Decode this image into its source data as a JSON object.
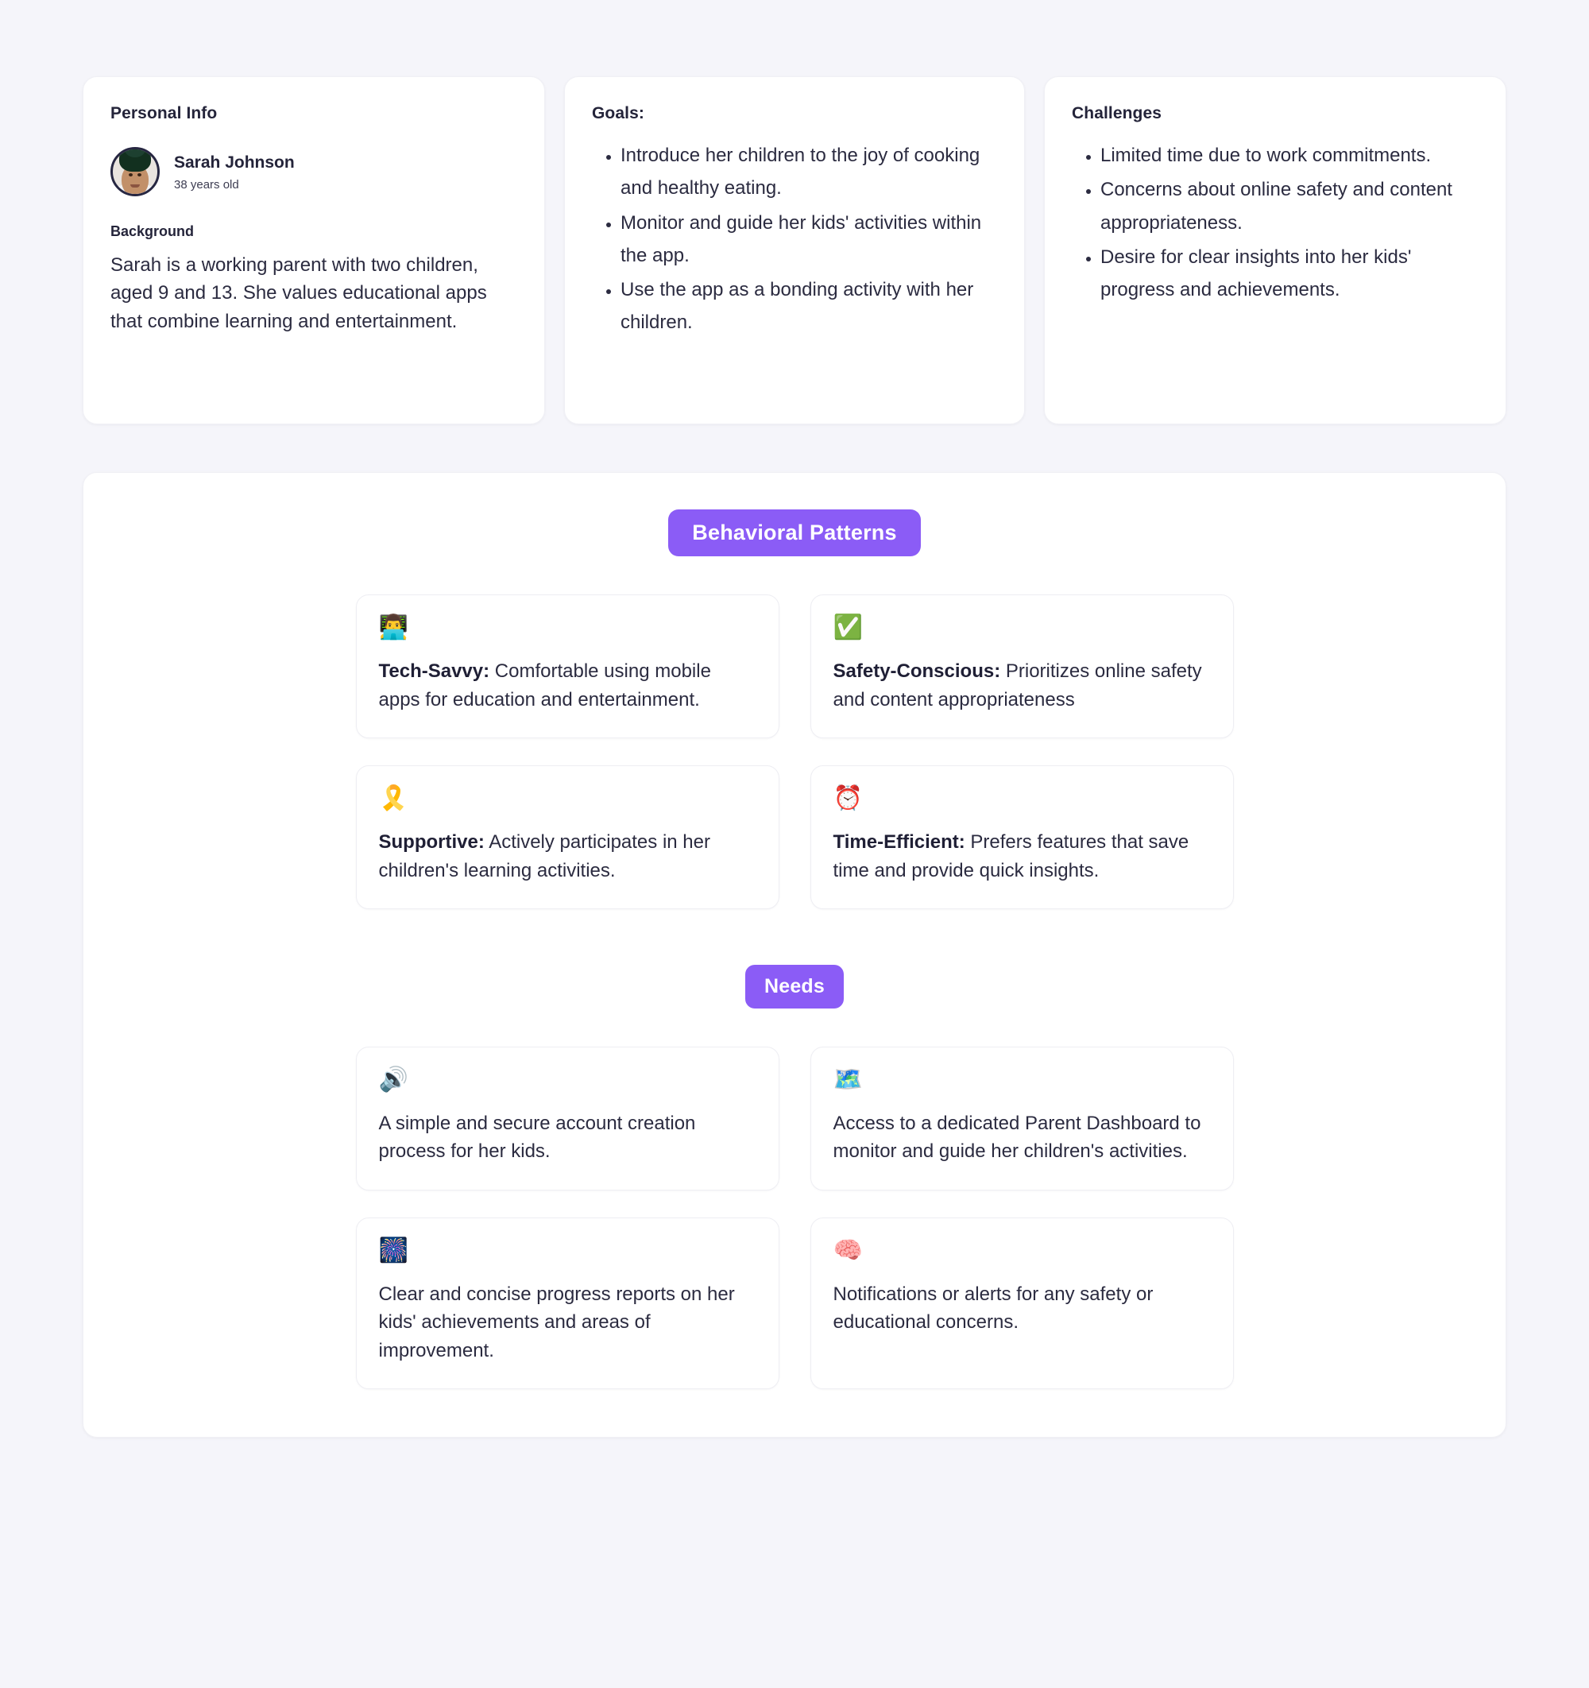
{
  "theme": {
    "page_background": "#f5f5fa",
    "card_background": "#ffffff",
    "accent_purple": "#8b5cf6",
    "text_color": "#2b2b40"
  },
  "personal_info": {
    "title": "Personal Info",
    "name": "Sarah Johnson",
    "age": "38 years old",
    "background_label": "Background",
    "background_text": "Sarah is a working parent with two children, aged 9 and 13. She values educational apps that combine learning and entertainment.",
    "avatar_icon": "avatar-photo"
  },
  "goals": {
    "title": "Goals:",
    "items": [
      "Introduce her children to the joy of cooking and healthy eating.",
      "Monitor and guide her kids' activities within the app.",
      "Use the app as a bonding activity with her children."
    ]
  },
  "challenges": {
    "title": "Challenges",
    "items": [
      "Limited time due to work commitments.",
      "Concerns about online safety and content appropriateness.",
      "Desire for clear insights into her kids' progress and achievements."
    ]
  },
  "behavioral_patterns": {
    "badge": "Behavioral Patterns",
    "items": [
      {
        "icon": "👨‍💻",
        "icon_name": "technologist-icon",
        "label": "Tech-Savvy:",
        "text": " Comfortable using mobile apps for education and entertainment."
      },
      {
        "icon": "✅",
        "icon_name": "check-mark-button-icon",
        "label": "Safety-Conscious:",
        "text": " Prioritizes online safety and content appropriateness"
      },
      {
        "icon": "🎗️",
        "icon_name": "reminder-ribbon-icon",
        "label": "Supportive:",
        "text": " Actively participates in her children's learning activities."
      },
      {
        "icon": "⏰",
        "icon_name": "alarm-clock-icon",
        "label": "Time-Efficient:",
        "text": " Prefers features that save time and provide quick insights."
      }
    ]
  },
  "needs": {
    "badge": "Needs",
    "items": [
      {
        "icon": "🔊",
        "icon_name": "speaker-high-volume-icon",
        "text": "A simple and secure account creation process for her kids."
      },
      {
        "icon": "🗺️",
        "icon_name": "world-map-icon",
        "text": "Access to a dedicated Parent Dashboard to monitor and guide her children's activities."
      },
      {
        "icon": "🎆",
        "icon_name": "fireworks-icon",
        "text": "Clear and concise progress reports on her kids' achievements and areas of improvement."
      },
      {
        "icon": "🧠",
        "icon_name": "brain-icon",
        "text": "Notifications or alerts for any safety or educational concerns."
      }
    ]
  }
}
